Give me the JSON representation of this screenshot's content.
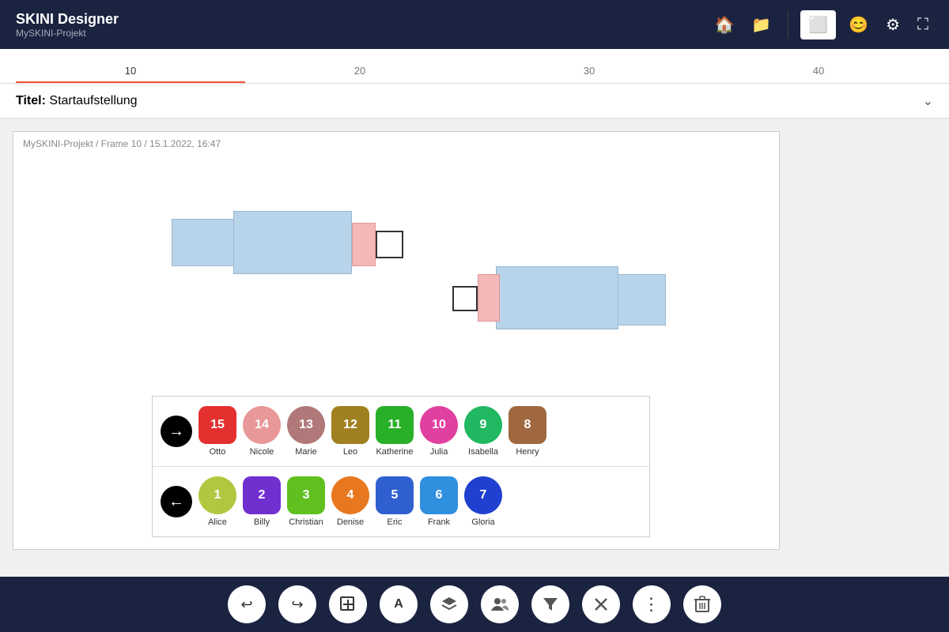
{
  "header": {
    "app_name": "SKINI Designer",
    "project_name": "MySKINI-Projekt",
    "icons": {
      "home": "🏠",
      "folder": "📁",
      "frame": "⬜",
      "face": "😊",
      "settings": "⚙",
      "fullscreen": "⛶"
    }
  },
  "timeline": {
    "items": [
      "10",
      "20",
      "30",
      "40"
    ],
    "active_index": 0
  },
  "title_bar": {
    "label": "Titel:",
    "value": "Startaufstellung",
    "chevron": "›"
  },
  "canvas": {
    "breadcrumb": "MySKINI-Projekt / Frame 10 / 15.1.2022, 16:47"
  },
  "player_rows": [
    {
      "nav": "→",
      "nav_type": "forward",
      "players": [
        {
          "number": 15,
          "name": "Otto",
          "color": "#e53030",
          "shape": "rounded"
        },
        {
          "number": 14,
          "name": "Nicole",
          "color": "#e89898",
          "shape": "circle"
        },
        {
          "number": 13,
          "name": "Marie",
          "color": "#b07878",
          "shape": "circle"
        },
        {
          "number": 12,
          "name": "Leo",
          "color": "#a08020",
          "shape": "rounded"
        },
        {
          "number": 11,
          "name": "Katherine",
          "color": "#28b028",
          "shape": "rounded"
        },
        {
          "number": 10,
          "name": "Julia",
          "color": "#e040a0",
          "shape": "circle"
        },
        {
          "number": 9,
          "name": "Isabella",
          "color": "#20b860",
          "shape": "circle"
        },
        {
          "number": 8,
          "name": "Henry",
          "color": "#a06840",
          "shape": "rounded"
        }
      ]
    },
    {
      "nav": "←",
      "nav_type": "back",
      "players": [
        {
          "number": 1,
          "name": "Alice",
          "color": "#b0c840",
          "shape": "circle"
        },
        {
          "number": 2,
          "name": "Billy",
          "color": "#7030d0",
          "shape": "rounded"
        },
        {
          "number": 3,
          "name": "Christian",
          "color": "#60c020",
          "shape": "rounded"
        },
        {
          "number": 4,
          "name": "Denise",
          "color": "#e87820",
          "shape": "circle"
        },
        {
          "number": 5,
          "name": "Eric",
          "color": "#3060d0",
          "shape": "rounded"
        },
        {
          "number": 6,
          "name": "Frank",
          "color": "#3090e0",
          "shape": "rounded"
        },
        {
          "number": 7,
          "name": "Gloria",
          "color": "#2040d0",
          "shape": "circle"
        }
      ]
    }
  ],
  "toolbar": {
    "buttons": [
      {
        "icon": "↩",
        "name": "undo"
      },
      {
        "icon": "↪",
        "name": "redo"
      },
      {
        "icon": "⊞",
        "name": "add-frame"
      },
      {
        "icon": "A",
        "name": "text"
      },
      {
        "icon": "◆",
        "name": "layers"
      },
      {
        "icon": "👥",
        "name": "players"
      },
      {
        "icon": "▼",
        "name": "filter"
      },
      {
        "icon": "✕",
        "name": "tools"
      },
      {
        "icon": "⋮",
        "name": "more"
      },
      {
        "icon": "🗑",
        "name": "delete"
      }
    ]
  }
}
